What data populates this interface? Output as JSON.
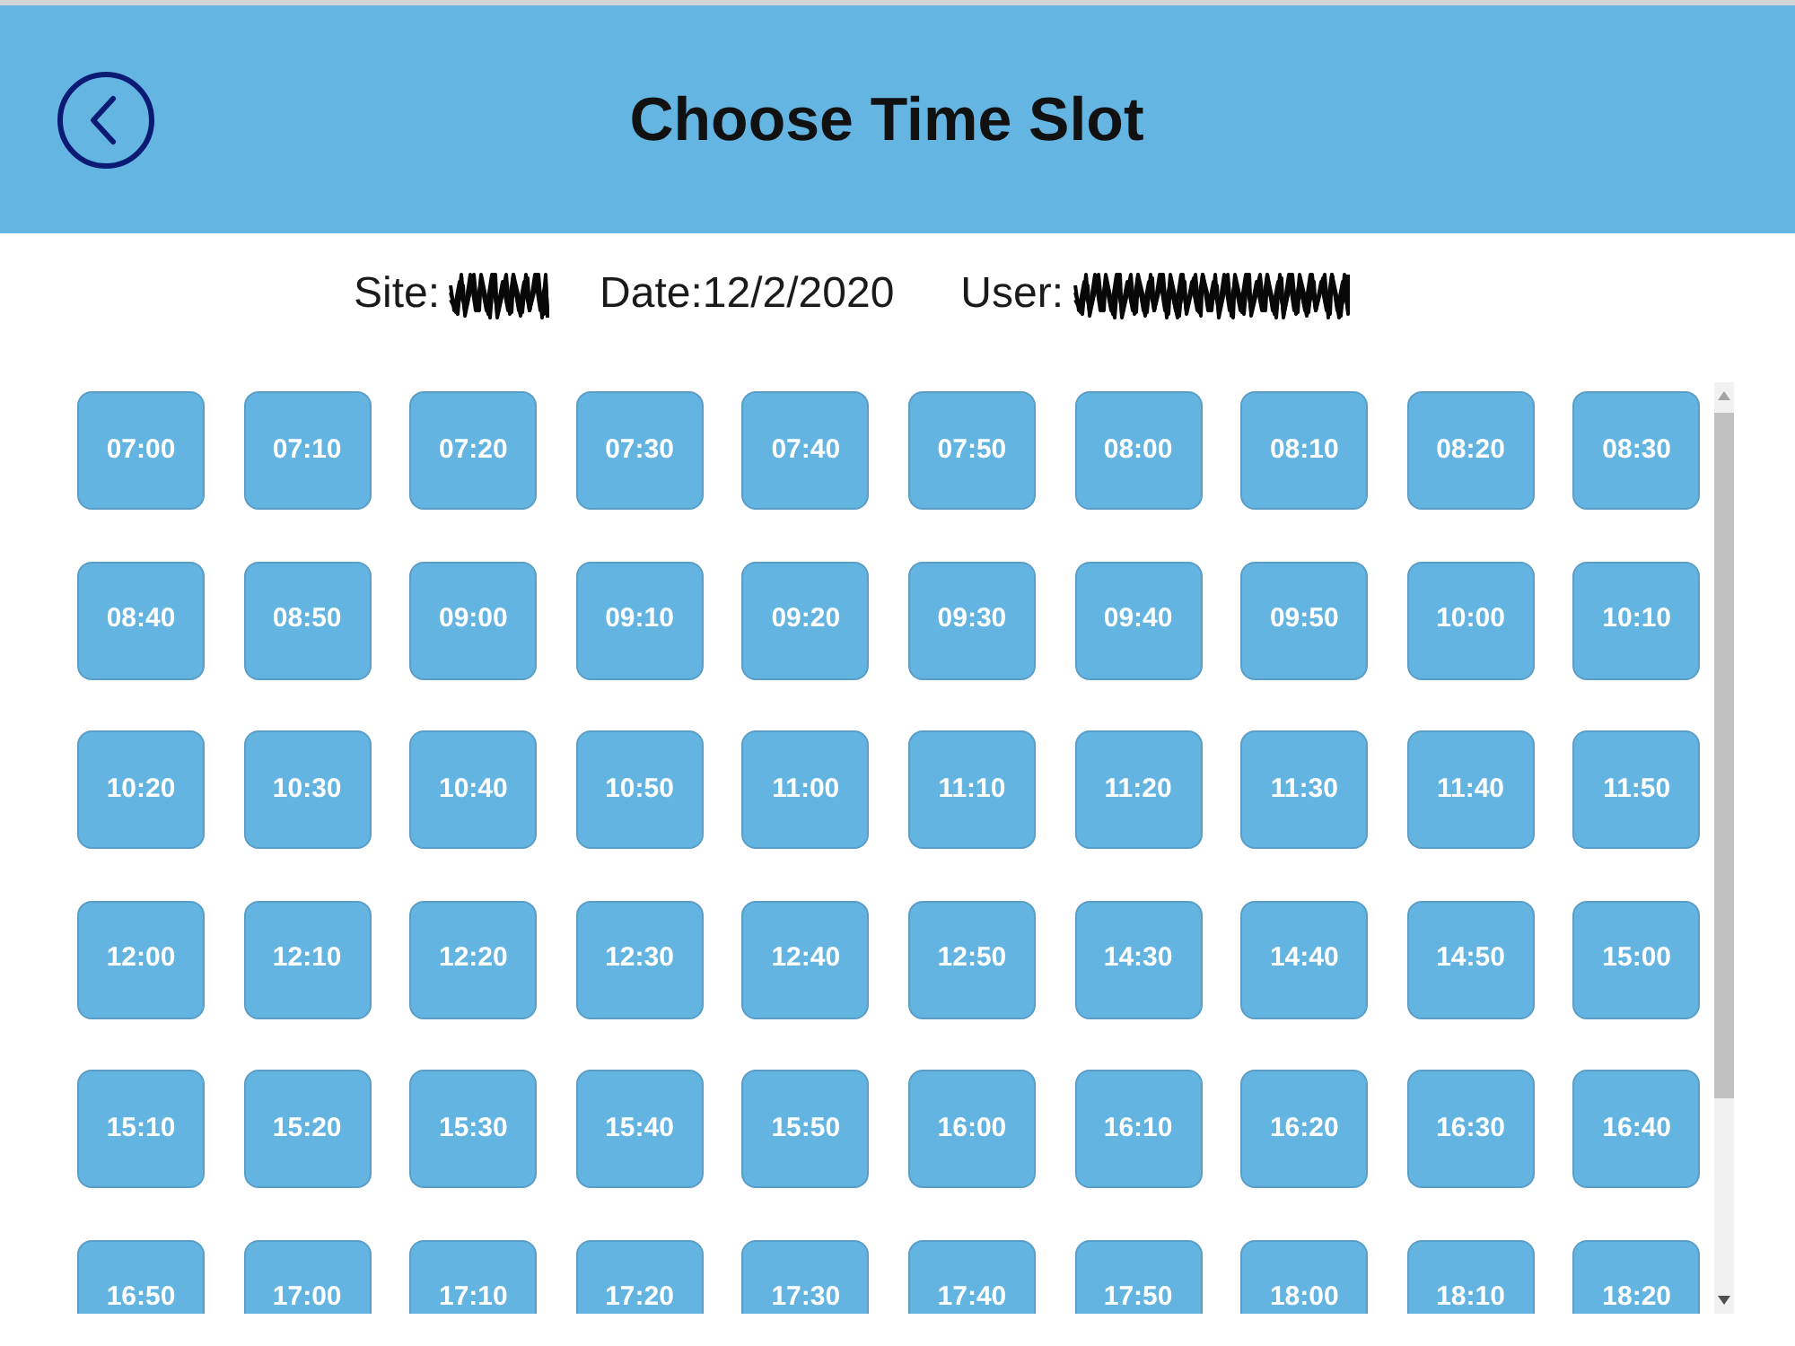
{
  "header": {
    "title": "Choose Time Slot"
  },
  "info": [
    {
      "label": "Site:",
      "redacted": true
    },
    {
      "label": "Date:12/2/2020",
      "redacted": false
    },
    {
      "label": "User:",
      "redacted": true
    }
  ],
  "time_slots": [
    "07:00",
    "07:10",
    "07:20",
    "07:30",
    "07:40",
    "07:50",
    "08:00",
    "08:10",
    "08:20",
    "08:30",
    "08:40",
    "08:50",
    "09:00",
    "09:10",
    "09:20",
    "09:30",
    "09:40",
    "09:50",
    "10:00",
    "10:10",
    "10:20",
    "10:30",
    "10:40",
    "10:50",
    "11:00",
    "11:10",
    "11:20",
    "11:30",
    "11:40",
    "11:50",
    "12:00",
    "12:10",
    "12:20",
    "12:30",
    "12:40",
    "12:50",
    "14:30",
    "14:40",
    "14:50",
    "15:00",
    "15:10",
    "15:20",
    "15:30",
    "15:40",
    "15:50",
    "16:00",
    "16:10",
    "16:20",
    "16:30",
    "16:40",
    "16:50",
    "17:00",
    "17:10",
    "17:20",
    "17:30",
    "17:40",
    "17:50",
    "18:00",
    "18:10",
    "18:20"
  ]
}
